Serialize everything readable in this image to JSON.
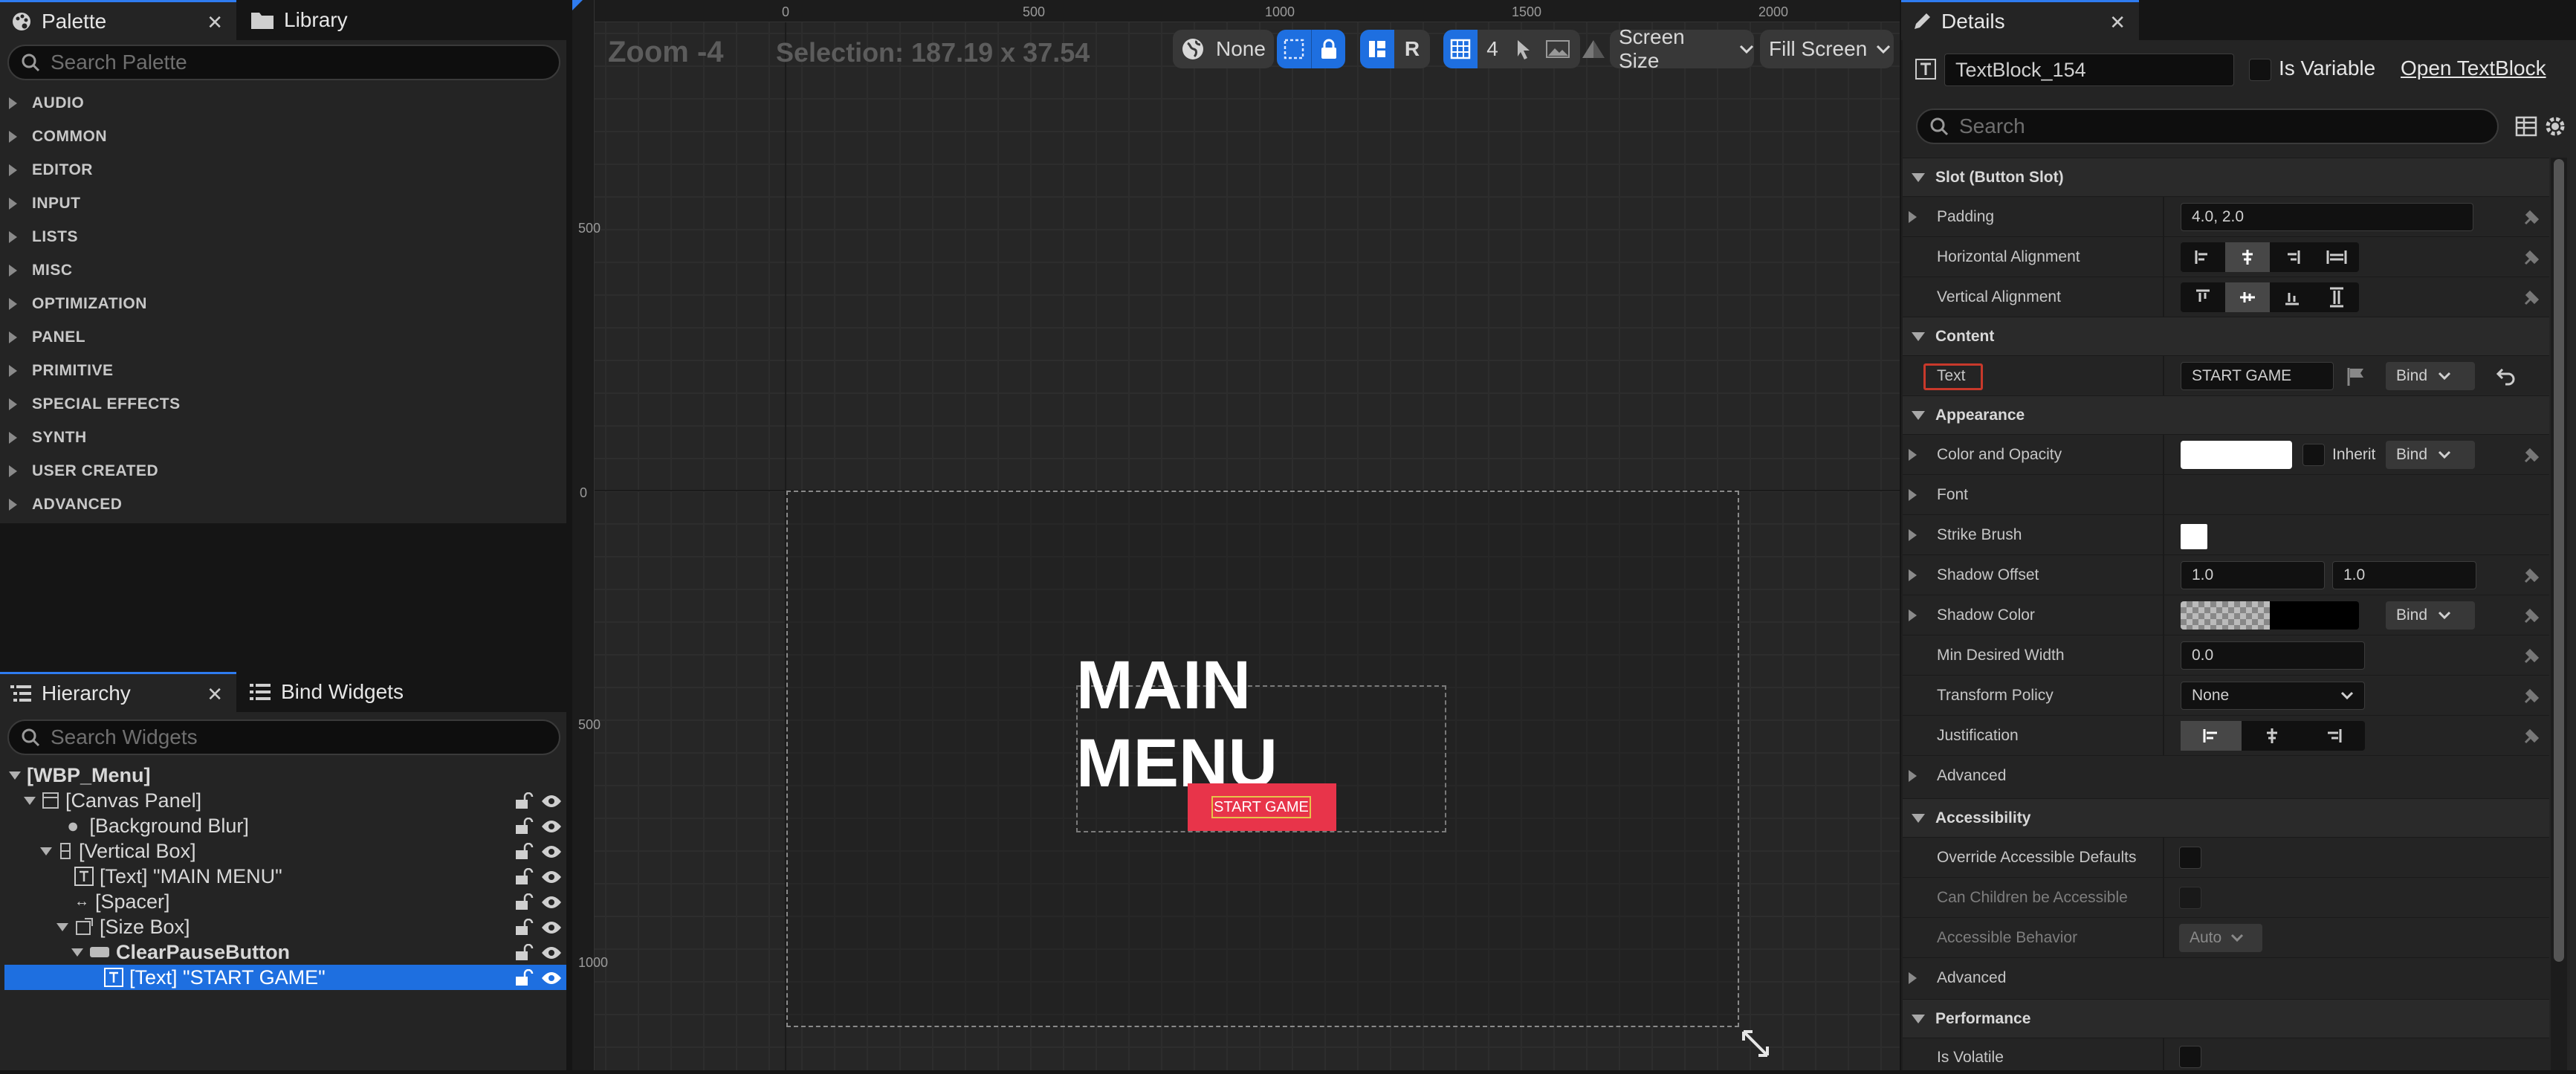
{
  "palette": {
    "tab_label": "Palette",
    "library_tab_label": "Library",
    "search_placeholder": "Search Palette",
    "categories": [
      "AUDIO",
      "COMMON",
      "EDITOR",
      "INPUT",
      "LISTS",
      "MISC",
      "OPTIMIZATION",
      "PANEL",
      "PRIMITIVE",
      "SPECIAL EFFECTS",
      "SYNTH",
      "USER CREATED",
      "ADVANCED"
    ]
  },
  "hierarchy": {
    "tab_label": "Hierarchy",
    "bind_tab_label": "Bind Widgets",
    "search_placeholder": "Search Widgets",
    "items": [
      {
        "label": "[WBP_Menu]"
      },
      {
        "label": "[Canvas Panel]"
      },
      {
        "label": "[Background Blur]"
      },
      {
        "label": "[Vertical Box]"
      },
      {
        "label": "[Text] \"MAIN MENU\""
      },
      {
        "label": "[Spacer]"
      },
      {
        "label": "[Size Box]"
      },
      {
        "label": "ClearPauseButton"
      },
      {
        "label": "[Text] \"START GAME\""
      }
    ]
  },
  "viewport": {
    "zoom": "Zoom -4",
    "selection": "Selection: 187.19 x 37.54",
    "ruler_top": [
      "0",
      "500",
      "1000",
      "1500",
      "2000"
    ],
    "ruler_left": [
      "500",
      "0",
      "500",
      "1000"
    ],
    "toolbar": {
      "localization": "None",
      "r_label": "R",
      "grid_size": "4",
      "screen_size": "Screen Size",
      "fill_screen": "Fill Screen"
    },
    "title_text": "MAIN MENU",
    "button_text": "START GAME",
    "button_color": "#e8344a"
  },
  "details": {
    "tab_label": "Details",
    "widget_name": "TextBlock_154",
    "is_variable_label": "Is Variable",
    "open_link": "Open TextBlock",
    "search_placeholder": "Search",
    "sections": {
      "slot": "Slot (Button Slot)",
      "content": "Content",
      "appearance": "Appearance",
      "accessibility": "Accessibility",
      "performance": "Performance"
    },
    "padding_label": "Padding",
    "padding_value": "4.0, 2.0",
    "h_align_label": "Horizontal Alignment",
    "v_align_label": "Vertical Alignment",
    "text_label": "Text",
    "text_value": "START GAME",
    "bind_label": "Bind",
    "color_label": "Color and Opacity",
    "inherit_label": "Inherit",
    "font_label": "Font",
    "strike_label": "Strike Brush",
    "shadow_offset_label": "Shadow Offset",
    "shadow_offset_x": "1.0",
    "shadow_offset_y": "1.0",
    "shadow_color_label": "Shadow Color",
    "min_width_label": "Min Desired Width",
    "min_width_value": "0.0",
    "transform_policy_label": "Transform Policy",
    "transform_policy_value": "None",
    "justification_label": "Justification",
    "advanced_label": "Advanced",
    "override_label": "Override Accessible Defaults",
    "children_label": "Can Children be Accessible",
    "behavior_label": "Accessible Behavior",
    "behavior_value": "Auto",
    "is_volatile_label": "Is Volatile"
  },
  "colors": {
    "accent_blue": "#1e6fe0",
    "highlight_red": "#c8392b"
  }
}
